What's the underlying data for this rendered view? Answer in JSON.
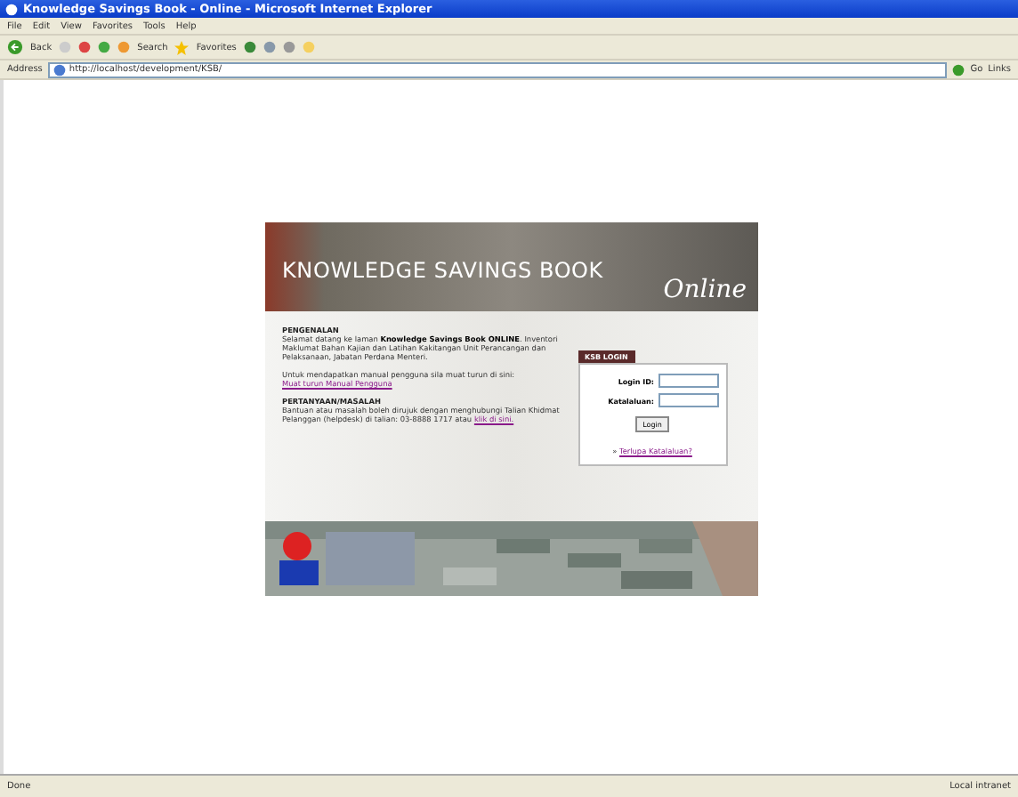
{
  "window": {
    "title": "Knowledge Savings Book - Online - Microsoft Internet Explorer"
  },
  "menu": [
    "File",
    "Edit",
    "View",
    "Favorites",
    "Tools",
    "Help"
  ],
  "toolbar": {
    "back": "Back",
    "search": "Search",
    "favorites": "Favorites"
  },
  "address_bar": {
    "label": "Address",
    "url": "http://localhost/development/KSB/",
    "go": "Go",
    "links": "Links"
  },
  "banner": {
    "title": "KNOWLEDGE SAVINGS BOOK",
    "script": "Online"
  },
  "intro": {
    "heading": "PENGENALAN",
    "text": "Selamat datang ke laman **Knowledge Savings Book ONLINE**. Inventori Maklumat Bahan Kajian dan Latihan Kakitangan Unit Perancangan dan Pelaksanaan, Jabatan Perdana Menteri.",
    "manual_text": "Untuk mendapatkan manual pengguna sila muat turun di sini:",
    "manual_link": "Muat turun Manual Pengguna"
  },
  "help": {
    "heading": "PERTANYAAN/MASALAH",
    "text": "Bantuan atau masalah boleh dirujuk dengan menghubungi Talian Khidmat Pelanggan (helpdesk) di talian: 03-8888 1717 atau",
    "link": "klik di sini."
  },
  "login": {
    "tab": "KSB LOGIN",
    "id_label": "Login ID:",
    "password_label": "Katalaluan:",
    "button": "Login",
    "forgot_prefix": "»",
    "forgot_link": "Terlupa Katalaluan?"
  },
  "status_bar": {
    "text": "Done",
    "zone": "Local intranet"
  }
}
